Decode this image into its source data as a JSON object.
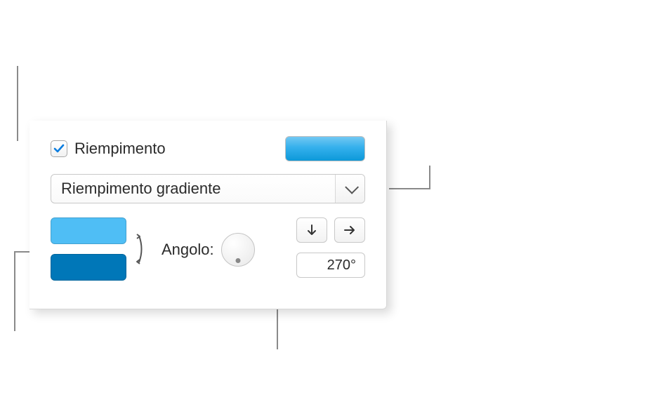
{
  "fill": {
    "checkbox_checked": true,
    "label": "Riempimento",
    "preview_gradient_top": "#72c8f3",
    "preview_gradient_bottom": "#0d99d9",
    "type_selected": "Riempimento gradiente",
    "stops": {
      "top_color": "#4fbef5",
      "bottom_color": "#0077b8"
    },
    "angle": {
      "label": "Angolo:",
      "value_text": "270°",
      "value": 270
    },
    "direction_buttons": {
      "down": "↓",
      "right": "→"
    }
  }
}
